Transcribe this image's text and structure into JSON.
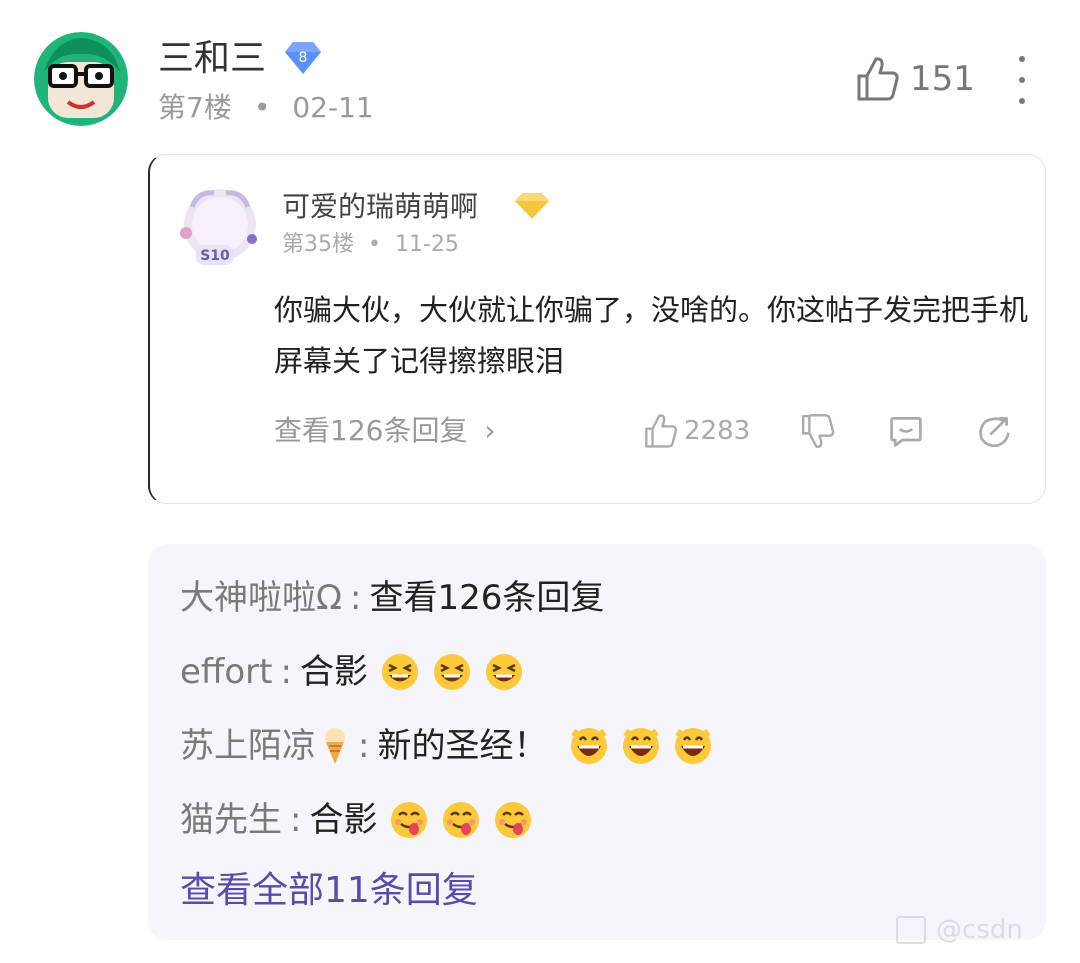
{
  "comment": {
    "username": "三和三",
    "level": "8",
    "floor": "第7楼",
    "separator": "•",
    "date": "02-11",
    "likes": "151"
  },
  "quoted": {
    "username": "可爱的瑞萌萌啊",
    "avatar_tag": "S10",
    "floor": "第35楼",
    "separator": "•",
    "date": "11-25",
    "body": "你骗大伙，大伙就让你骗了，没啥的。你这帖子发完把手机屏幕关了记得擦擦眼泪",
    "view_replies": "查看126条回复",
    "chevron": "›",
    "likes": "2283"
  },
  "sub_replies": [
    {
      "author": "大神啦啦Ω",
      "sep": ":",
      "text": "查看126条回复",
      "emoji": []
    },
    {
      "author": "effort",
      "sep": ":",
      "text": "合影",
      "emoji": [
        "grin-squint-emoji",
        "grin-squint-emoji",
        "grin-squint-emoji"
      ]
    },
    {
      "author": "苏上陌凉",
      "sep": ":",
      "text": "新的圣经！",
      "emoji": [
        "laugh-emoji",
        "laugh-emoji",
        "laugh-emoji"
      ]
    },
    {
      "author": "猫先生",
      "sep": ":",
      "text": "合影",
      "emoji": [
        "yum-emoji",
        "yum-emoji",
        "yum-emoji"
      ]
    }
  ],
  "view_all": "查看全部11条回复",
  "watermark": "@csdn",
  "colors": {
    "link_purple": "#5a4ba8",
    "sub_bg": "#f5f5fb",
    "badge_blue": "#5b8ff9",
    "badge_gold": "#f5c542"
  }
}
